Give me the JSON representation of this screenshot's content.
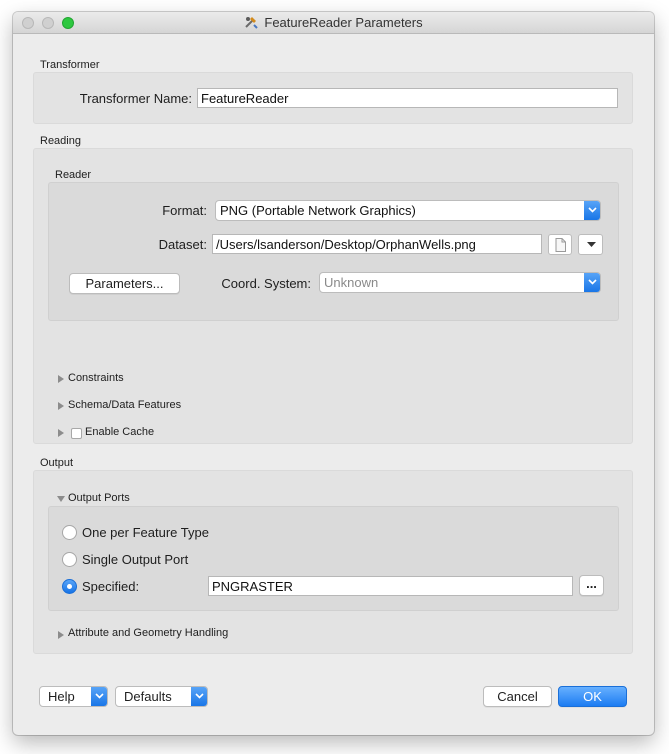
{
  "window": {
    "title": "FeatureReader Parameters"
  },
  "transformer": {
    "section_label": "Transformer",
    "name_label": "Transformer Name:",
    "name_value": "FeatureReader"
  },
  "reading": {
    "section_label": "Reading",
    "reader_label": "Reader",
    "format_label": "Format:",
    "format_value": "PNG (Portable Network Graphics)",
    "dataset_label": "Dataset:",
    "dataset_value": "/Users/lsanderson/Desktop/OrphanWells.png",
    "parameters_button": "Parameters...",
    "coord_label": "Coord. System:",
    "coord_value": "Unknown",
    "constraints_label": "Constraints",
    "schema_label": "Schema/Data Features",
    "cache_label": "Enable Cache"
  },
  "output": {
    "section_label": "Output",
    "ports_label": "Output Ports",
    "opt_one": "One per Feature Type",
    "opt_single": "Single Output Port",
    "opt_specified": "Specified:",
    "specified_value": "PNGRASTER",
    "browse_button": "...",
    "attr_label": "Attribute and Geometry Handling"
  },
  "footer": {
    "help": "Help",
    "defaults": "Defaults",
    "cancel": "Cancel",
    "ok": "OK"
  },
  "colors": {
    "accent": "#1c7cf2",
    "panel": "#e3e3e3",
    "window": "#ececec"
  }
}
